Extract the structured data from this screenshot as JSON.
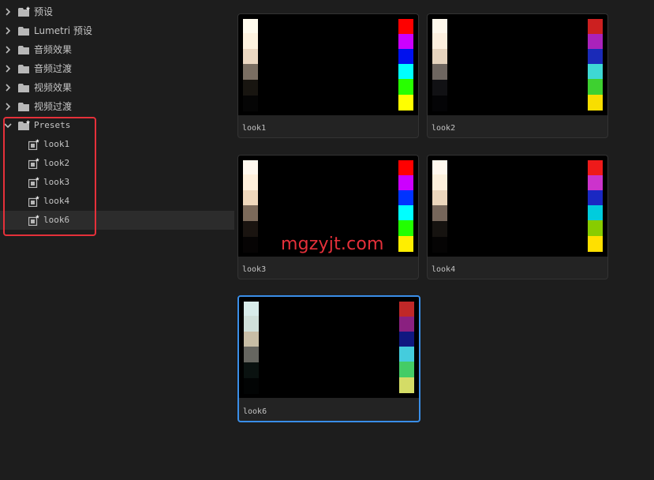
{
  "tree": {
    "items": [
      {
        "label": "预设",
        "expanded": false
      },
      {
        "label": "Lumetri 预设",
        "expanded": false
      },
      {
        "label": "音频效果",
        "expanded": false
      },
      {
        "label": "音频过渡",
        "expanded": false
      },
      {
        "label": "视频效果",
        "expanded": false
      },
      {
        "label": "视频过渡",
        "expanded": false
      },
      {
        "label": "Presets",
        "expanded": true
      }
    ],
    "children": [
      {
        "label": "look1"
      },
      {
        "label": "look2"
      },
      {
        "label": "look3"
      },
      {
        "label": "look4"
      },
      {
        "label": "look6",
        "selected": true
      }
    ]
  },
  "cards": [
    {
      "label": "look1",
      "left": [
        "#fffbee",
        "#fef3e0",
        "#ecd8c2",
        "#7a6e62",
        "#181510",
        "#050505"
      ],
      "right": [
        "#fe0000",
        "#cc00ff",
        "#0011ee",
        "#00ffff",
        "#28ff00",
        "#ffff00"
      ]
    },
    {
      "label": "look2",
      "left": [
        "#fef8ec",
        "#fcefde",
        "#e6d4be",
        "#6e6660",
        "#111114",
        "#040406"
      ],
      "right": [
        "#cc2020",
        "#aa22bb",
        "#1a2ab8",
        "#3ed8d4",
        "#3ed030",
        "#f8de00"
      ]
    },
    {
      "label": "look3",
      "left": [
        "#fff8ee",
        "#fff0dc",
        "#f0d8bc",
        "#7c6a5a",
        "#1a1410",
        "#060404"
      ],
      "right": [
        "#ff0000",
        "#cc00ff",
        "#0033ff",
        "#00ffff",
        "#22ff00",
        "#ffee00"
      ]
    },
    {
      "label": "look4",
      "left": [
        "#fff8ee",
        "#fcf0dc",
        "#ecd6bc",
        "#76665a",
        "#161310",
        "#050404"
      ],
      "right": [
        "#ee1a1a",
        "#cc33cc",
        "#1a28c2",
        "#00ccdd",
        "#88cc00",
        "#ffe000"
      ]
    },
    {
      "label": "look6",
      "selected": true,
      "left": [
        "#d8ecea",
        "#d0e0da",
        "#c8bea6",
        "#666660",
        "#0a1210",
        "#020404"
      ],
      "right": [
        "#c02828",
        "#8a2080",
        "#101880",
        "#44ccdd",
        "#44cc66",
        "#d4dc66"
      ]
    }
  ],
  "watermark": "mgzyjt.com"
}
